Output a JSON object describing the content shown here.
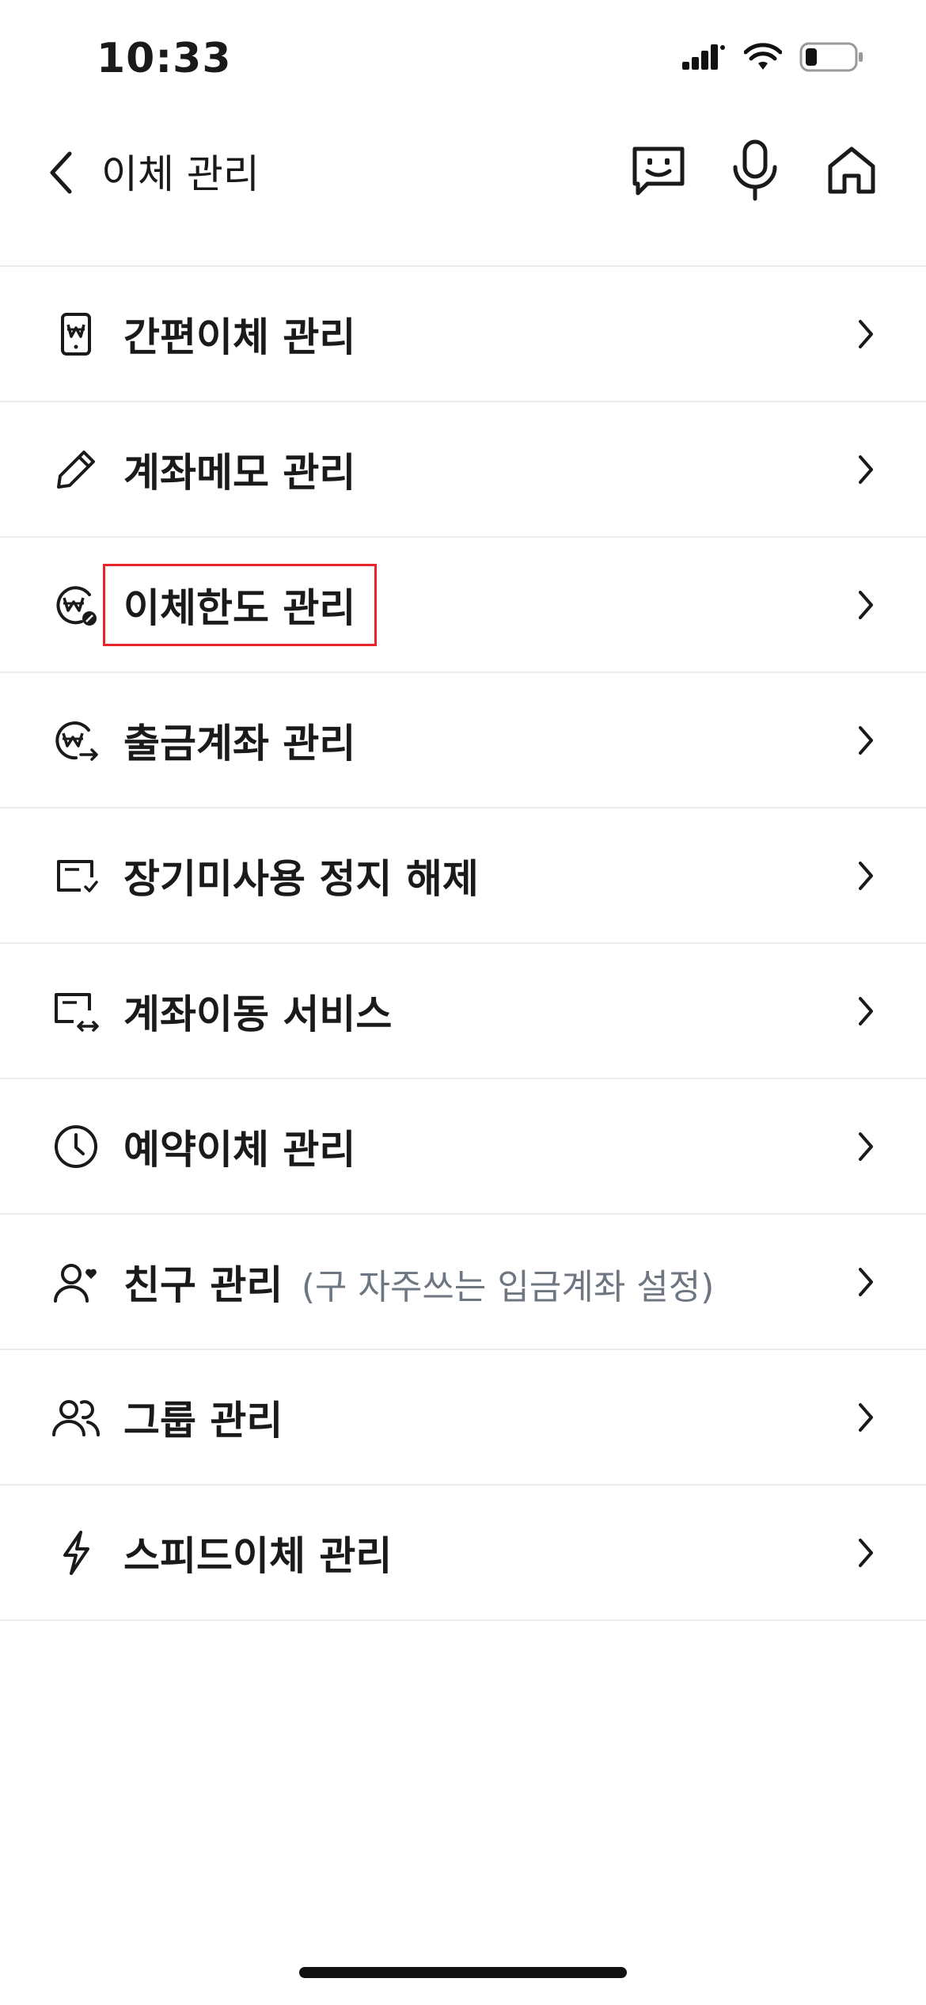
{
  "status_bar": {
    "time": "10:33"
  },
  "nav": {
    "title": "이체 관리",
    "back_icon": "chevron-left-icon",
    "actions": [
      "chatbot-icon",
      "microphone-icon",
      "home-icon"
    ]
  },
  "menu": {
    "items": [
      {
        "label": "간편이체 관리",
        "icon": "phone-won-icon"
      },
      {
        "label": "계좌메모 관리",
        "icon": "pencil-icon"
      },
      {
        "label": "이체한도 관리",
        "icon": "won-limit-icon",
        "highlighted": true
      },
      {
        "label": "출금계좌 관리",
        "icon": "won-outgoing-icon"
      },
      {
        "label": "장기미사용 정지 해제",
        "icon": "account-check-icon"
      },
      {
        "label": "계좌이동 서비스",
        "icon": "account-transfer-icon"
      },
      {
        "label": "예약이체 관리",
        "icon": "clock-icon"
      },
      {
        "label": "친구 관리",
        "sublabel": "(구 자주쓰는 입금계좌 설정)",
        "icon": "person-heart-icon"
      },
      {
        "label": "그룹 관리",
        "icon": "group-icon"
      },
      {
        "label": "스피드이체 관리",
        "icon": "lightning-icon"
      }
    ]
  },
  "colors": {
    "highlight": "#e8242b",
    "divider": "#ececec",
    "text": "#1a1a1a",
    "sublabel": "#6e7681"
  }
}
